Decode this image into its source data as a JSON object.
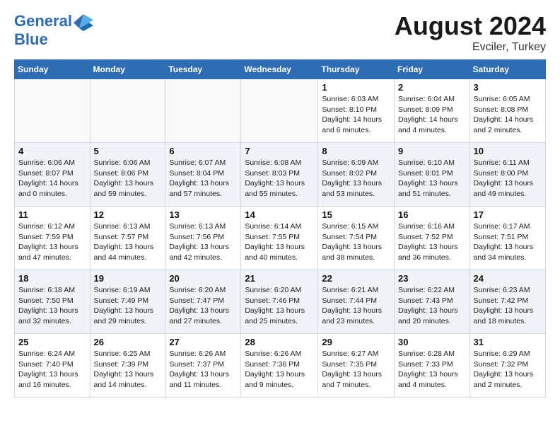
{
  "header": {
    "logo_line1": "General",
    "logo_line2": "Blue",
    "title": "August 2024",
    "subtitle": "Evciler, Turkey"
  },
  "weekdays": [
    "Sunday",
    "Monday",
    "Tuesday",
    "Wednesday",
    "Thursday",
    "Friday",
    "Saturday"
  ],
  "weeks": [
    [
      {
        "day": "",
        "info": ""
      },
      {
        "day": "",
        "info": ""
      },
      {
        "day": "",
        "info": ""
      },
      {
        "day": "",
        "info": ""
      },
      {
        "day": "1",
        "info": "Sunrise: 6:03 AM\nSunset: 8:10 PM\nDaylight: 14 hours and 6 minutes."
      },
      {
        "day": "2",
        "info": "Sunrise: 6:04 AM\nSunset: 8:09 PM\nDaylight: 14 hours and 4 minutes."
      },
      {
        "day": "3",
        "info": "Sunrise: 6:05 AM\nSunset: 8:08 PM\nDaylight: 14 hours and 2 minutes."
      }
    ],
    [
      {
        "day": "4",
        "info": "Sunrise: 6:06 AM\nSunset: 8:07 PM\nDaylight: 14 hours and 0 minutes."
      },
      {
        "day": "5",
        "info": "Sunrise: 6:06 AM\nSunset: 8:06 PM\nDaylight: 13 hours and 59 minutes."
      },
      {
        "day": "6",
        "info": "Sunrise: 6:07 AM\nSunset: 8:04 PM\nDaylight: 13 hours and 57 minutes."
      },
      {
        "day": "7",
        "info": "Sunrise: 6:08 AM\nSunset: 8:03 PM\nDaylight: 13 hours and 55 minutes."
      },
      {
        "day": "8",
        "info": "Sunrise: 6:09 AM\nSunset: 8:02 PM\nDaylight: 13 hours and 53 minutes."
      },
      {
        "day": "9",
        "info": "Sunrise: 6:10 AM\nSunset: 8:01 PM\nDaylight: 13 hours and 51 minutes."
      },
      {
        "day": "10",
        "info": "Sunrise: 6:11 AM\nSunset: 8:00 PM\nDaylight: 13 hours and 49 minutes."
      }
    ],
    [
      {
        "day": "11",
        "info": "Sunrise: 6:12 AM\nSunset: 7:59 PM\nDaylight: 13 hours and 47 minutes."
      },
      {
        "day": "12",
        "info": "Sunrise: 6:13 AM\nSunset: 7:57 PM\nDaylight: 13 hours and 44 minutes."
      },
      {
        "day": "13",
        "info": "Sunrise: 6:13 AM\nSunset: 7:56 PM\nDaylight: 13 hours and 42 minutes."
      },
      {
        "day": "14",
        "info": "Sunrise: 6:14 AM\nSunset: 7:55 PM\nDaylight: 13 hours and 40 minutes."
      },
      {
        "day": "15",
        "info": "Sunrise: 6:15 AM\nSunset: 7:54 PM\nDaylight: 13 hours and 38 minutes."
      },
      {
        "day": "16",
        "info": "Sunrise: 6:16 AM\nSunset: 7:52 PM\nDaylight: 13 hours and 36 minutes."
      },
      {
        "day": "17",
        "info": "Sunrise: 6:17 AM\nSunset: 7:51 PM\nDaylight: 13 hours and 34 minutes."
      }
    ],
    [
      {
        "day": "18",
        "info": "Sunrise: 6:18 AM\nSunset: 7:50 PM\nDaylight: 13 hours and 32 minutes."
      },
      {
        "day": "19",
        "info": "Sunrise: 6:19 AM\nSunset: 7:49 PM\nDaylight: 13 hours and 29 minutes."
      },
      {
        "day": "20",
        "info": "Sunrise: 6:20 AM\nSunset: 7:47 PM\nDaylight: 13 hours and 27 minutes."
      },
      {
        "day": "21",
        "info": "Sunrise: 6:20 AM\nSunset: 7:46 PM\nDaylight: 13 hours and 25 minutes."
      },
      {
        "day": "22",
        "info": "Sunrise: 6:21 AM\nSunset: 7:44 PM\nDaylight: 13 hours and 23 minutes."
      },
      {
        "day": "23",
        "info": "Sunrise: 6:22 AM\nSunset: 7:43 PM\nDaylight: 13 hours and 20 minutes."
      },
      {
        "day": "24",
        "info": "Sunrise: 6:23 AM\nSunset: 7:42 PM\nDaylight: 13 hours and 18 minutes."
      }
    ],
    [
      {
        "day": "25",
        "info": "Sunrise: 6:24 AM\nSunset: 7:40 PM\nDaylight: 13 hours and 16 minutes."
      },
      {
        "day": "26",
        "info": "Sunrise: 6:25 AM\nSunset: 7:39 PM\nDaylight: 13 hours and 14 minutes."
      },
      {
        "day": "27",
        "info": "Sunrise: 6:26 AM\nSunset: 7:37 PM\nDaylight: 13 hours and 11 minutes."
      },
      {
        "day": "28",
        "info": "Sunrise: 6:26 AM\nSunset: 7:36 PM\nDaylight: 13 hours and 9 minutes."
      },
      {
        "day": "29",
        "info": "Sunrise: 6:27 AM\nSunset: 7:35 PM\nDaylight: 13 hours and 7 minutes."
      },
      {
        "day": "30",
        "info": "Sunrise: 6:28 AM\nSunset: 7:33 PM\nDaylight: 13 hours and 4 minutes."
      },
      {
        "day": "31",
        "info": "Sunrise: 6:29 AM\nSunset: 7:32 PM\nDaylight: 13 hours and 2 minutes."
      }
    ]
  ]
}
